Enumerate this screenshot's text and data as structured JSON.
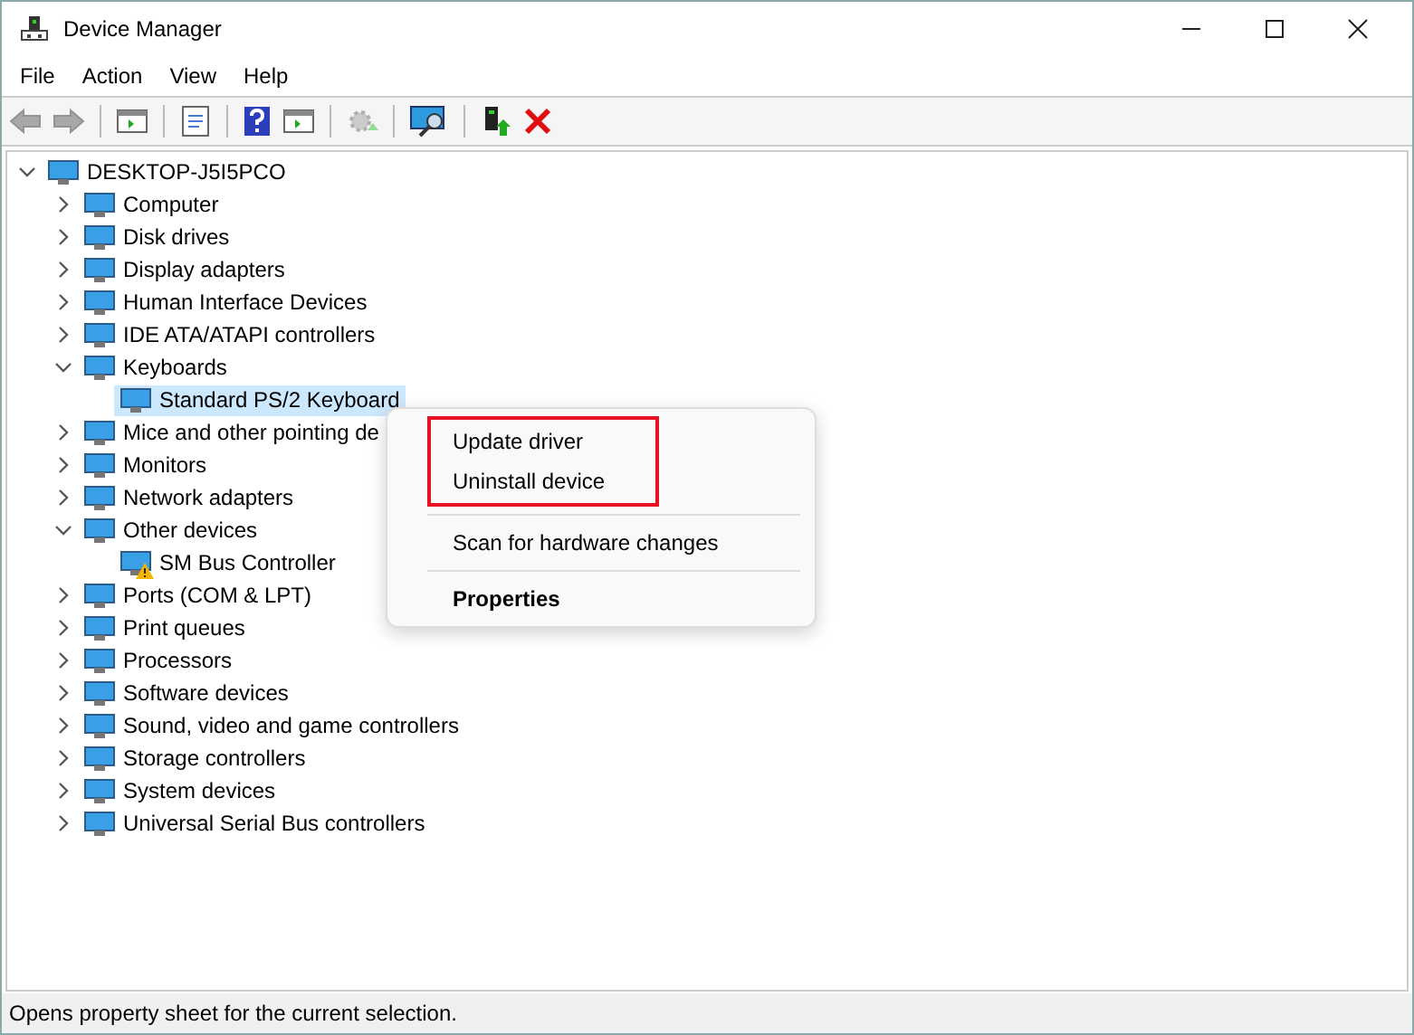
{
  "window": {
    "title": "Device Manager"
  },
  "menu_bar": [
    "File",
    "Action",
    "View",
    "Help"
  ],
  "toolbar": [
    {
      "kind": "back",
      "disabled": true
    },
    {
      "kind": "forward",
      "disabled": true
    },
    {
      "kind": "separator"
    },
    {
      "kind": "pane",
      "disabled": false
    },
    {
      "kind": "separator"
    },
    {
      "kind": "properties",
      "disabled": false
    },
    {
      "kind": "separator"
    },
    {
      "kind": "help",
      "disabled": false
    },
    {
      "kind": "pane",
      "disabled": false
    },
    {
      "kind": "separator"
    },
    {
      "kind": "update",
      "disabled": true
    },
    {
      "kind": "separator"
    },
    {
      "kind": "scan",
      "disabled": false
    },
    {
      "kind": "separator"
    },
    {
      "kind": "enable",
      "disabled": false
    },
    {
      "kind": "uninstall",
      "disabled": false
    }
  ],
  "tree": [
    {
      "label": "DESKTOP-J5I5PCO",
      "expanded": true,
      "selected": false,
      "children": [
        {
          "label": "Computer",
          "expanded": false,
          "selected": false
        },
        {
          "label": "Disk drives",
          "expanded": false,
          "selected": false
        },
        {
          "label": "Display adapters",
          "expanded": false,
          "selected": false
        },
        {
          "label": "Human Interface Devices",
          "expanded": false,
          "selected": false
        },
        {
          "label": "IDE ATA/ATAPI controllers",
          "expanded": false,
          "selected": false
        },
        {
          "label": "Keyboards",
          "expanded": true,
          "selected": false,
          "children": [
            {
              "label": "Standard PS/2 Keyboard",
              "selected": true
            }
          ]
        },
        {
          "label": "Mice and other pointing de",
          "expanded": false,
          "selected": false
        },
        {
          "label": "Monitors",
          "expanded": false,
          "selected": false
        },
        {
          "label": "Network adapters",
          "expanded": false,
          "selected": false
        },
        {
          "label": "Other devices",
          "expanded": true,
          "selected": false,
          "children": [
            {
              "label": "SM Bus Controller",
              "selected": false,
              "warning": true
            }
          ]
        },
        {
          "label": "Ports (COM & LPT)",
          "expanded": false,
          "selected": false
        },
        {
          "label": "Print queues",
          "expanded": false,
          "selected": false
        },
        {
          "label": "Processors",
          "expanded": false,
          "selected": false
        },
        {
          "label": "Software devices",
          "expanded": false,
          "selected": false
        },
        {
          "label": "Sound, video and game controllers",
          "expanded": false,
          "selected": false
        },
        {
          "label": "Storage controllers",
          "expanded": false,
          "selected": false
        },
        {
          "label": "System devices",
          "expanded": false,
          "selected": false
        },
        {
          "label": "Universal Serial Bus controllers",
          "expanded": false,
          "selected": false
        }
      ]
    }
  ],
  "context_menu": {
    "sections": [
      {
        "highlighted": true,
        "items": [
          {
            "label": "Update driver",
            "bold": false
          },
          {
            "label": "Uninstall device",
            "bold": false
          }
        ]
      },
      {
        "highlighted": false,
        "items": [
          {
            "label": "Scan for hardware changes",
            "bold": false
          }
        ]
      },
      {
        "highlighted": false,
        "items": [
          {
            "label": "Properties",
            "bold": true
          }
        ]
      }
    ]
  },
  "status_bar": "Opens property sheet for the current selection."
}
